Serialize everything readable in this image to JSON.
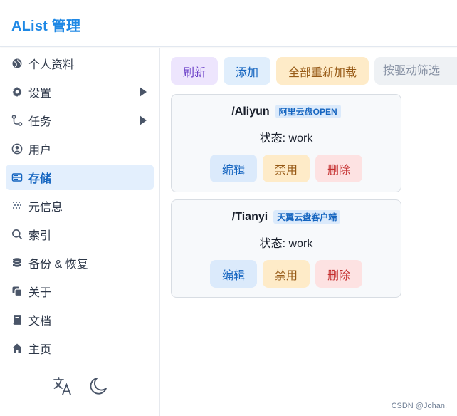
{
  "header": {
    "brand": "AList 管理"
  },
  "sidebar": {
    "items": [
      {
        "label": "个人资料",
        "icon": "globe-icon"
      },
      {
        "label": "设置",
        "icon": "gear-icon",
        "has_arrow": true
      },
      {
        "label": "任务",
        "icon": "branch-icon",
        "has_arrow": true
      },
      {
        "label": "用户",
        "icon": "user-circle-icon"
      },
      {
        "label": "存储",
        "icon": "storage-icon",
        "active": true
      },
      {
        "label": "元信息",
        "icon": "grid-dots-icon"
      },
      {
        "label": "索引",
        "icon": "search-icon"
      },
      {
        "label": "备份 & 恢复",
        "icon": "database-icon"
      },
      {
        "label": "关于",
        "icon": "copy-icon"
      },
      {
        "label": "文档",
        "icon": "book-icon"
      },
      {
        "label": "主页",
        "icon": "home-icon"
      }
    ],
    "footer": {
      "language_icon": "translate-icon",
      "theme_icon": "moon-icon"
    }
  },
  "toolbar": {
    "refresh": "刷新",
    "add": "添加",
    "reload_all": "全部重新加载",
    "filter_placeholder": "按驱动筛选"
  },
  "storages": [
    {
      "path": "/Aliyun",
      "driver": "阿里云盘OPEN",
      "status": "状态: work",
      "edit": "编辑",
      "disable": "禁用",
      "delete": "删除"
    },
    {
      "path": "/Tianyi",
      "driver": "天翼云盘客户端",
      "status": "状态: work",
      "edit": "编辑",
      "disable": "禁用",
      "delete": "删除"
    }
  ],
  "watermark": "CSDN @Johan.",
  "colors": {
    "brand": "#1e88e5",
    "active_bg": "#e3effd",
    "purple_btn": "#ede5fd",
    "blue_btn": "#e0eefc",
    "yellow_btn": "#feebc8",
    "red_btn": "#fde2e2"
  }
}
